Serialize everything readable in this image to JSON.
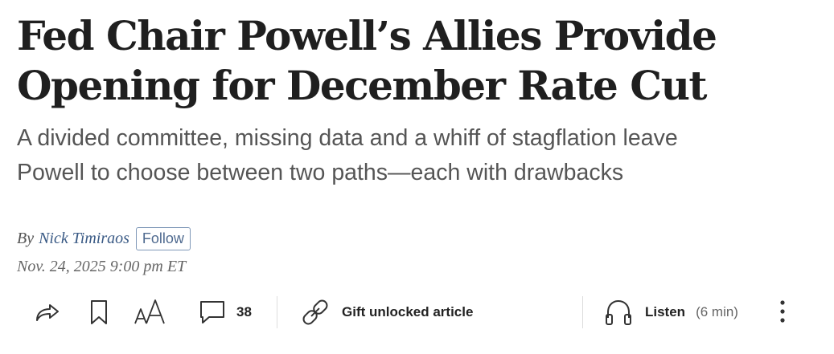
{
  "article": {
    "headline_line1": "Fed Chair Powell’s Allies Provide",
    "headline_line2": "Opening for December Rate Cut",
    "dek_line1": "A divided committee, missing data and a whiff of stagflation leave",
    "dek_line2": "Powell to choose between two paths—each with drawbacks",
    "byline_prefix": "By",
    "author": "Nick Timiraos",
    "follow_label": "Follow",
    "timestamp": "Nov. 24, 2025 9:00 pm ET"
  },
  "toolbar": {
    "share_icon": "share-icon",
    "bookmark_icon": "bookmark-icon",
    "text_size_icon": "text-size-icon",
    "comments_icon": "comment-icon",
    "comment_count": "38",
    "gift_icon": "link-icon",
    "gift_label": "Gift unlocked article",
    "listen_icon": "headphones-icon",
    "listen_label": "Listen",
    "listen_duration": "(6 min)",
    "more_icon": "more-vertical-icon"
  },
  "colors": {
    "author_link": "#3a5a85",
    "follow_border": "#7f98b8",
    "headline": "#1f1f1f",
    "dek": "#555555"
  }
}
